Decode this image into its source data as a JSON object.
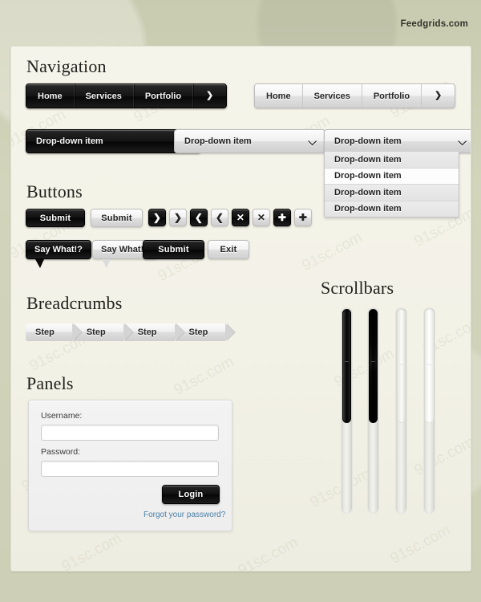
{
  "site": {
    "name": "Feedgrids.com"
  },
  "sections": {
    "navigation": "Navigation",
    "buttons": "Buttons",
    "breadcrumbs": "Breadcrumbs",
    "scrollbars": "Scrollbars",
    "panels": "Panels"
  },
  "navbar": {
    "items": [
      "Home",
      "Services",
      "Portfolio"
    ],
    "arrow_icon": "chevron-right-icon",
    "arrow_glyph": "❯"
  },
  "dropdown": {
    "label": "Drop-down item",
    "caret_icon": "chevron-down-icon",
    "caret_glyph": "⌵",
    "options": [
      {
        "label": "Drop-down item",
        "selected": false
      },
      {
        "label": "Drop-down item",
        "selected": true
      },
      {
        "label": "Drop-down item",
        "selected": false
      },
      {
        "label": "Drop-down item",
        "selected": false
      }
    ]
  },
  "buttons": {
    "submit_dark": "Submit",
    "submit_light": "Submit",
    "submit_pair": "Submit",
    "exit": "Exit",
    "icons": [
      {
        "name": "arrow-right-icon",
        "glyph": "❯",
        "style": "dark"
      },
      {
        "name": "arrow-right-icon",
        "glyph": "❯",
        "style": "light"
      },
      {
        "name": "arrow-left-icon",
        "glyph": "❮",
        "style": "dark"
      },
      {
        "name": "arrow-left-icon",
        "glyph": "❮",
        "style": "light"
      },
      {
        "name": "close-icon",
        "glyph": "✕",
        "style": "dark"
      },
      {
        "name": "close-icon",
        "glyph": "✕",
        "style": "light"
      },
      {
        "name": "plus-icon",
        "glyph": "✚",
        "style": "dark"
      },
      {
        "name": "plus-icon",
        "glyph": "✚",
        "style": "light"
      }
    ],
    "bubble_dark": "Say What!?",
    "bubble_light": "Say What!?"
  },
  "breadcrumbs": {
    "steps": [
      "Step",
      "Step",
      "Step",
      "Step"
    ]
  },
  "panel": {
    "username_label": "Username:",
    "username_value": "",
    "username_placeholder": "",
    "password_label": "Password:",
    "password_value": "",
    "password_placeholder": "",
    "login_button": "Login",
    "forgot_link": "Forgot your password?"
  },
  "scrollbars": [
    {
      "name": "scrollbar-dark-1",
      "thumb": "dark-a"
    },
    {
      "name": "scrollbar-dark-2",
      "thumb": "dark-b"
    },
    {
      "name": "scrollbar-light-1",
      "thumb": "light-a"
    },
    {
      "name": "scrollbar-light-2",
      "thumb": "light-b"
    }
  ],
  "colors": {
    "page_background": "#ccceb4",
    "card_background": "#f3f2e7",
    "dark_control": "#111111",
    "light_control": "#e8e8e8",
    "link": "#4a7fa5"
  },
  "watermark": {
    "text": "91sc.com"
  }
}
